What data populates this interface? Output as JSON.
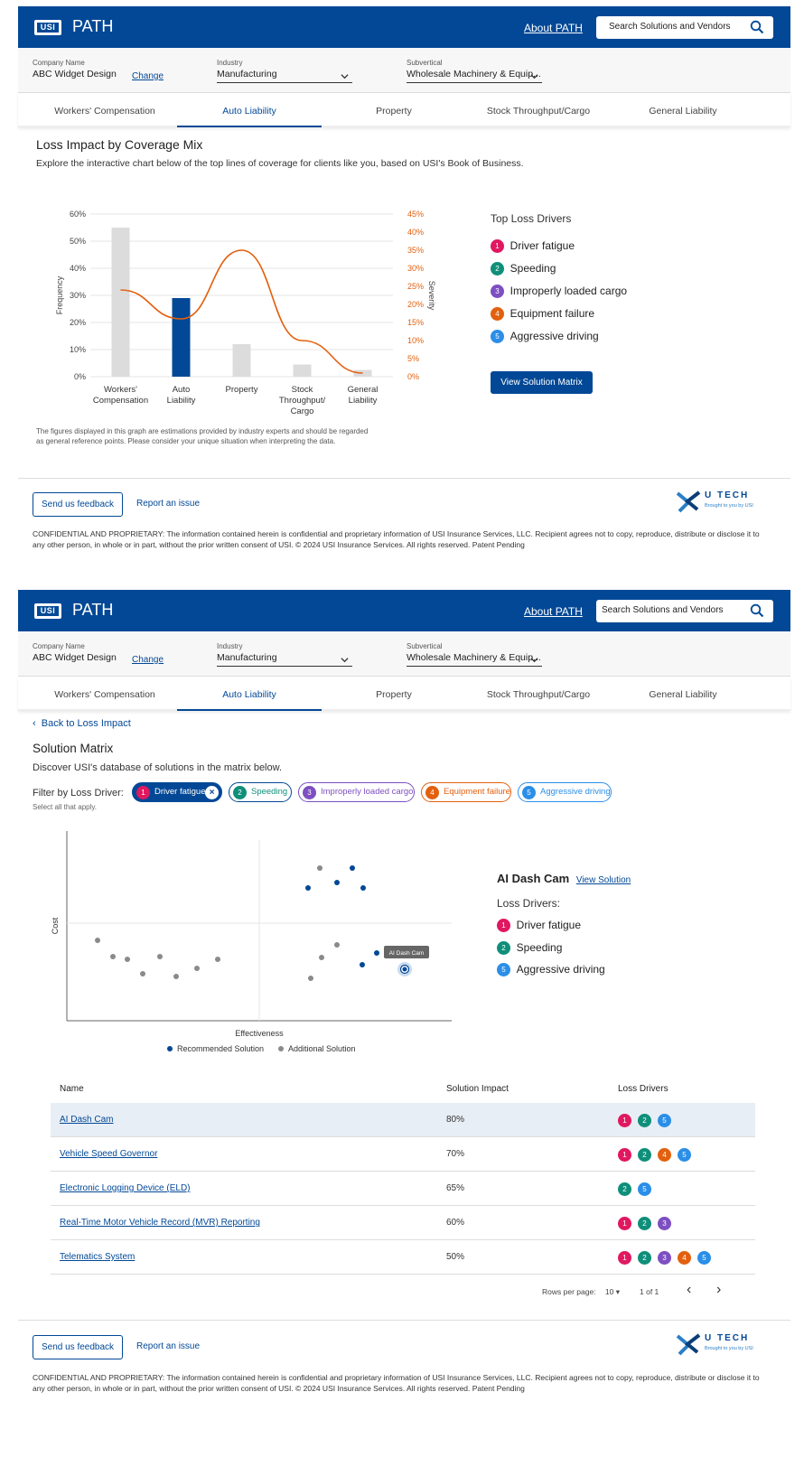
{
  "header": {
    "logo_text": "USI",
    "brand": "PATH",
    "about_link": "About PATH",
    "search_placeholder": "Search Solutions and Vendors"
  },
  "company": {
    "name_label": "Company Name",
    "name_value": "ABC Widget Design",
    "change_link": "Change",
    "industry_label": "Industry",
    "industry_value": "Manufacturing",
    "subvertical_label": "Subvertical",
    "subvertical_value": "Wholesale Machinery & Equip..."
  },
  "tabs": [
    {
      "label": "Workers' Compensation"
    },
    {
      "label": "Auto Liability"
    },
    {
      "label": "Property"
    },
    {
      "label": "Stock Throughput/Cargo"
    },
    {
      "label": "General Liability"
    }
  ],
  "active_tab": "Auto Liability",
  "loss_impact": {
    "title": "Loss Impact by Coverage Mix",
    "description": "Explore the interactive chart below of the top lines of coverage for clients like you, based on USI's Book of Business.",
    "disclaimer": "The figures displayed in this graph are estimations provided by industry experts and should be regarded as general reference points. Please consider your unique situation when interpreting the data.",
    "top_loss_drivers_title": "Top Loss Drivers",
    "view_matrix_button": "View Solution Matrix"
  },
  "loss_drivers": [
    {
      "num": "1",
      "label": "Driver fatigue",
      "color": "#e0185f"
    },
    {
      "num": "2",
      "label": "Speeding",
      "color": "#0f8f7a"
    },
    {
      "num": "3",
      "label": "Improperly loaded cargo",
      "color": "#7d4fc1"
    },
    {
      "num": "4",
      "label": "Equipment failure",
      "color": "#e2600e"
    },
    {
      "num": "5",
      "label": "Aggressive driving",
      "color": "#2b8ee8"
    }
  ],
  "chart_data": [
    {
      "type": "bar",
      "categories": [
        "Workers' Compensation",
        "Auto Liability",
        "Property",
        "Stock Throughput/ Cargo",
        "General Liability"
      ],
      "series": [
        {
          "name": "Frequency",
          "values": [
            55,
            29,
            12,
            4.5,
            2.5
          ],
          "colors": [
            "#dcdcdc",
            "#024896",
            "#dcdcdc",
            "#dcdcdc",
            "#dcdcdc"
          ]
        },
        {
          "name": "Severity",
          "type": "line",
          "values": [
            24,
            16,
            35,
            10,
            1
          ],
          "color": "#e2600e",
          "axis": "right"
        }
      ],
      "ylabel": "Frequency",
      "y2label": "Severity",
      "yticks": [
        "0%",
        "10%",
        "20%",
        "30%",
        "40%",
        "50%",
        "60%"
      ],
      "y2ticks": [
        "0%",
        "5%",
        "10%",
        "15%",
        "20%",
        "25%",
        "30%",
        "35%",
        "40%",
        "45%"
      ],
      "ylim": [
        0,
        60
      ],
      "y2lim": [
        0,
        45
      ]
    },
    {
      "type": "scatter",
      "xlabel": "Effectiveness",
      "ylabel": "Cost",
      "legend": [
        "Recommended Solution",
        "Additional Solution"
      ],
      "recommended_color": "#024896",
      "additional_color": "#8a8a8a"
    }
  ],
  "footer": {
    "feedback_button": "Send us feedback",
    "report_link": "Report an issue",
    "utech_name": "U TECH",
    "utech_tagline": "Brought to you by USI",
    "legal": "CONFIDENTIAL AND PROPRIETARY: The information contained herein is confidential and proprietary information of USI Insurance Services, LLC. Recipient agrees not to copy, reproduce, distribute or disclose it to any other person, in whole or in part, without the prior written consent of USI.    © 2024 USI Insurance Services. All rights reserved. Patent Pending"
  },
  "matrix": {
    "back_link": "Back to Loss Impact",
    "title": "Solution Matrix",
    "description": "Discover USI's database of solutions in the matrix below.",
    "filter_label": "Filter by Loss Driver:",
    "filter_hint": "Select all that apply.",
    "tooltip": "AI Dash Cam",
    "detail_title": "AI Dash Cam",
    "detail_link": "View Solution",
    "detail_drivers_label": "Loss Drivers:",
    "detail_drivers": [
      {
        "num": "1",
        "label": "Driver fatigue",
        "color": "#e0185f"
      },
      {
        "num": "2",
        "label": "Speeding",
        "color": "#0f8f7a"
      },
      {
        "num": "5",
        "label": "Aggressive driving",
        "color": "#2b8ee8"
      }
    ]
  },
  "table": {
    "headers": [
      "Name",
      "Solution Impact",
      "Loss Drivers"
    ],
    "rows": [
      {
        "name": "AI Dash Cam",
        "impact": "80%",
        "drivers": [
          "1",
          "2",
          "5"
        ]
      },
      {
        "name": "Vehicle Speed Governor",
        "impact": "70%",
        "drivers": [
          "1",
          "2",
          "4",
          "5"
        ]
      },
      {
        "name": "Electronic Logging Device (ELD)",
        "impact": "65%",
        "drivers": [
          "2",
          "5"
        ]
      },
      {
        "name": "Real-Time Motor Vehicle Record (MVR) Reporting",
        "impact": "60%",
        "drivers": [
          "1",
          "2",
          "3"
        ]
      },
      {
        "name": "Telematics System",
        "impact": "50%",
        "drivers": [
          "1",
          "2",
          "3",
          "4",
          "5"
        ]
      }
    ],
    "rows_per_page_label": "Rows per page:",
    "rows_per_page_value": "10",
    "page_info": "1 of 1"
  }
}
